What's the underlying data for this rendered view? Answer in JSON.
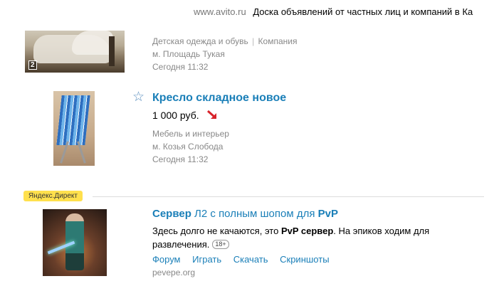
{
  "topbar": {
    "site": "www.avito.ru",
    "description": "Доска объявлений от частных лиц и компаний в Ка"
  },
  "listing1": {
    "photo_count": "2",
    "category": "Детская одежда и обувь",
    "separator": "|",
    "seller_type": "Компания",
    "metro": "м. Площадь Тукая",
    "date": "Сегодня 11:32"
  },
  "listing2": {
    "favorite_icon": "star-outline-icon",
    "title": "Кресло складное новое",
    "price": "1 000 руб.",
    "price_trend_icon": "arrow-down-red-icon",
    "trend_color": "#d8232a",
    "category": "Мебель и интерьер",
    "metro": "м. Козья Слобода",
    "date": "Сегодня 11:32"
  },
  "ad": {
    "badge": "Яндекс.Директ",
    "badge_color": "#ffe04d",
    "title_bold1": "Сервер",
    "title_mid": " Л2 с полным шопом для ",
    "title_bold2": "PvP",
    "text_before": "Здесь долго не качаются, это ",
    "text_bold": "PvP сервер",
    "text_after": ". На эпиков ходим для развлечения.",
    "age_label": "18+",
    "links": [
      "Форум",
      "Играть",
      "Скачать",
      "Скриншоты"
    ],
    "domain": "pevepe.org"
  },
  "colors": {
    "link": "#1a7fb8",
    "meta": "#888888"
  }
}
